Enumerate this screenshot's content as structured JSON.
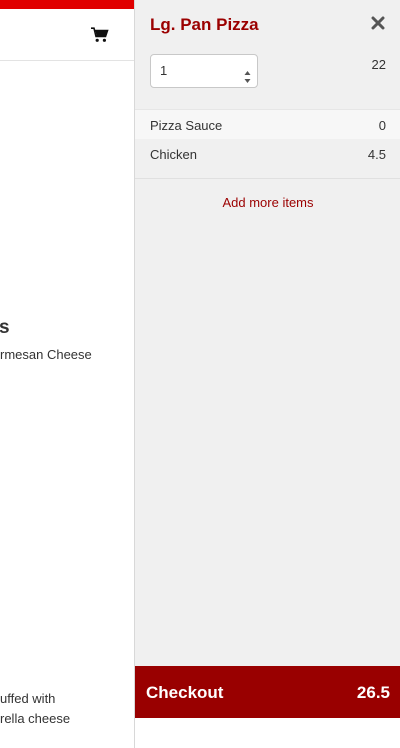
{
  "background_page": {
    "accent_color": "#e00000",
    "cart_icon": "shopping-cart-icon",
    "heading_fragment": "s",
    "description_fragment": "rmesan Cheese",
    "description2_line1": "uffed with",
    "description2_line2": "rella cheese"
  },
  "cart_panel": {
    "item_title": "Lg. Pan Pizza",
    "close_icon": "close-icon",
    "quantity": "1",
    "item_price": "22",
    "toppings": [
      {
        "name": "Pizza Sauce",
        "price": "0"
      },
      {
        "name": "Chicken",
        "price": "4.5"
      }
    ],
    "add_more_label": "Add more items",
    "checkout_label": "Checkout",
    "checkout_total": "26.5",
    "checkout_color": "#990000",
    "title_color": "#9b0000"
  }
}
